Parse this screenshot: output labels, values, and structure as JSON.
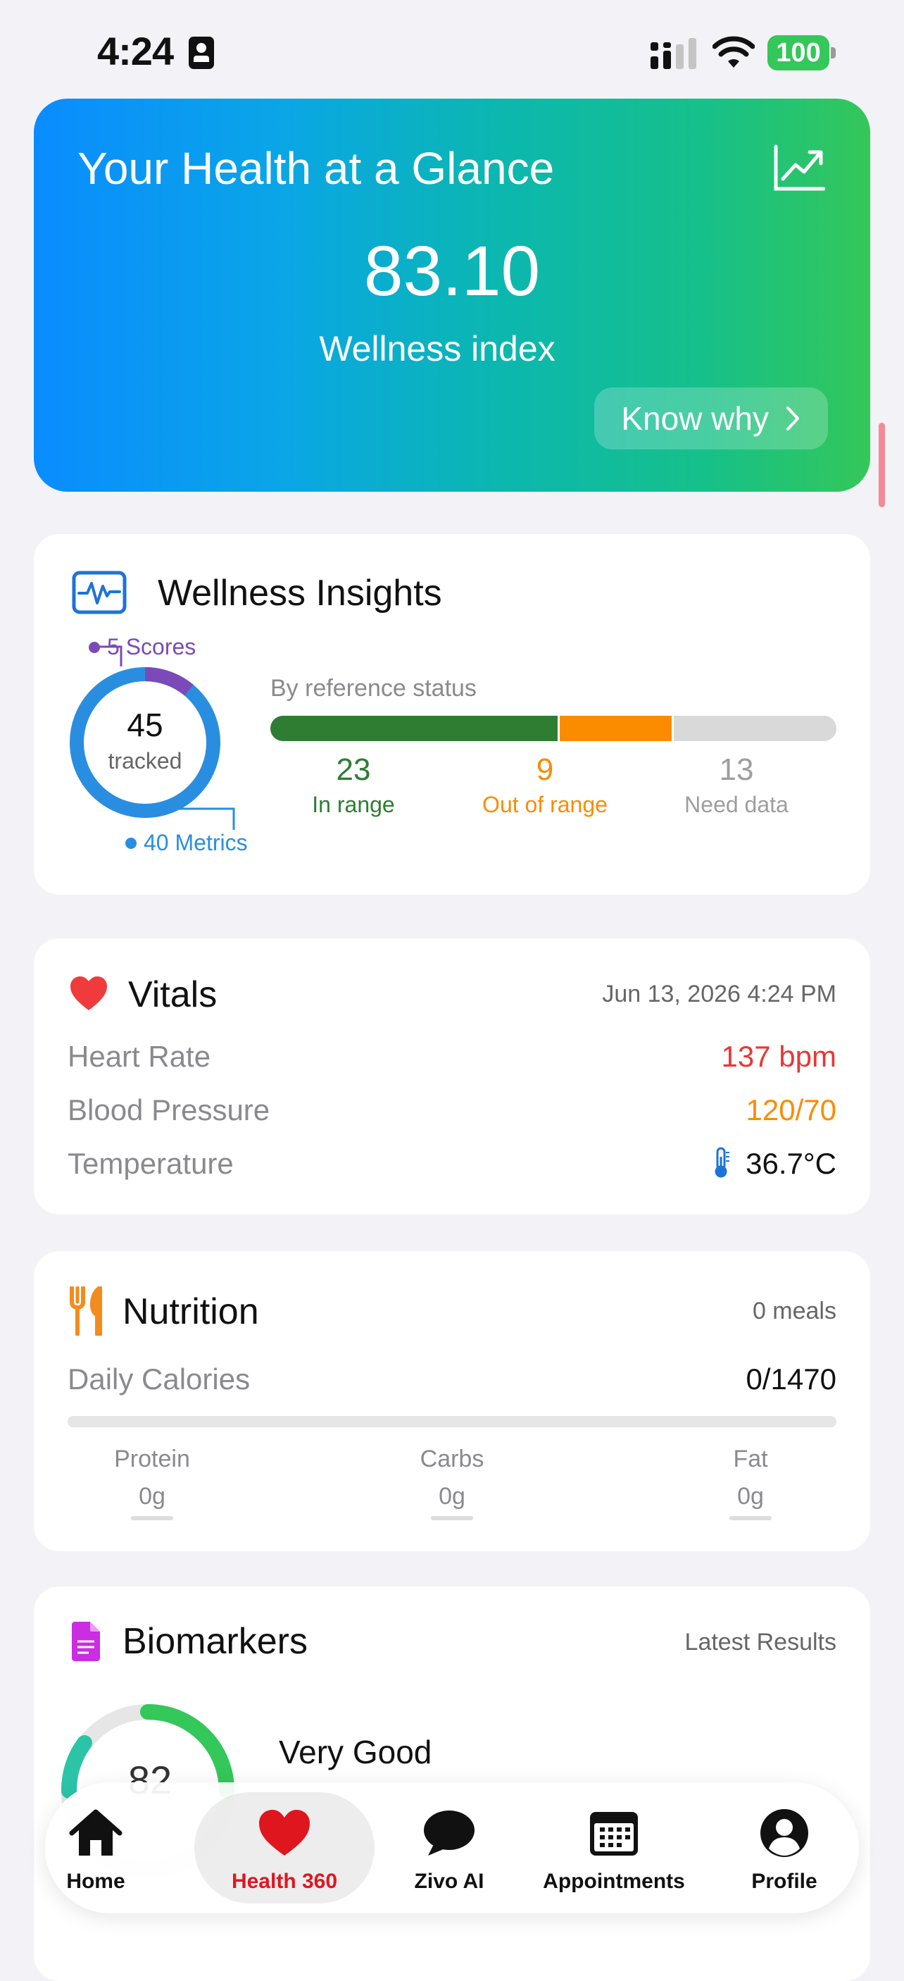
{
  "status_bar": {
    "time": "4:24",
    "battery": "100"
  },
  "hero": {
    "title": "Your Health at a Glance",
    "value": "83.10",
    "label": "Wellness index",
    "button": "Know why"
  },
  "wellness": {
    "title": "Wellness Insights",
    "tracked_count": "45",
    "tracked_label": "tracked",
    "scores_label": "5 Scores",
    "metrics_label": "40 Metrics",
    "ref_title": "By reference status",
    "stats": [
      {
        "value": "23",
        "label": "In range",
        "color": "#2e7d32"
      },
      {
        "value": "9",
        "label": "Out of range",
        "color": "#fb8c00"
      },
      {
        "value": "13",
        "label": "Need data",
        "color": "#9e9e9e"
      }
    ],
    "colors": {
      "scores": "#7b4ab8",
      "metrics": "#2a8ee0"
    }
  },
  "vitals": {
    "title": "Vitals",
    "date": "Jun 13, 2026 4:24 PM",
    "rows": [
      {
        "key": "Heart Rate",
        "value": "137 bpm",
        "color": "#e53935"
      },
      {
        "key": "Blood Pressure",
        "value": "120/70",
        "color": "#fb8c00"
      },
      {
        "key": "Temperature",
        "value": "36.7°C",
        "color": "#111111",
        "icon": "thermometer-icon"
      }
    ]
  },
  "nutrition": {
    "title": "Nutrition",
    "meals": "0 meals",
    "calories_label": "Daily Calories",
    "calories_value": "0/1470",
    "calories_progress": 0,
    "macros": [
      {
        "name": "Protein",
        "value": "0g"
      },
      {
        "name": "Carbs",
        "value": "0g"
      },
      {
        "name": "Fat",
        "value": "0g"
      }
    ]
  },
  "biomarkers": {
    "title": "Biomarkers",
    "latest": "Latest Results",
    "score": "82",
    "rating": "Very Good"
  },
  "tabs": [
    {
      "label": "Home",
      "icon": "home-icon",
      "active": false
    },
    {
      "label": "Health 360",
      "icon": "heart-icon",
      "active": true
    },
    {
      "label": "Zivo AI",
      "icon": "chat-bubble-icon",
      "active": false
    },
    {
      "label": "Appointments",
      "icon": "calendar-icon",
      "active": false
    },
    {
      "label": "Profile",
      "icon": "profile-icon",
      "active": false
    }
  ]
}
